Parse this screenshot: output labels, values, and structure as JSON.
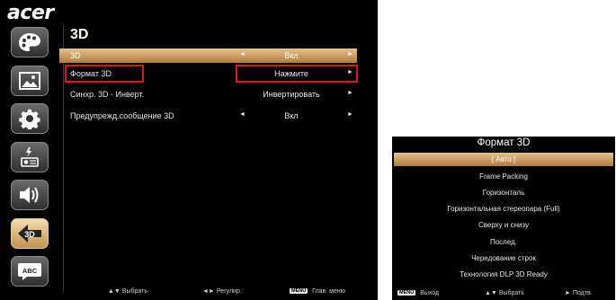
{
  "brand": "acer",
  "page_title": "3D",
  "sidebar": [
    {
      "icon": "palette-icon",
      "active": false
    },
    {
      "icon": "image-icon",
      "active": false
    },
    {
      "icon": "gear-icon",
      "active": false
    },
    {
      "icon": "projector-power-icon",
      "active": false
    },
    {
      "icon": "speaker-icon",
      "active": false
    },
    {
      "icon": "3d-icon",
      "active": true,
      "badge": "3D"
    },
    {
      "icon": "language-icon",
      "active": false,
      "badge": "ABC"
    }
  ],
  "menu": [
    {
      "label": "3D",
      "value": "Вкл",
      "left_arrow": "◄",
      "right_arrow": "►",
      "selected": true
    },
    {
      "label": "Формат 3D",
      "value": "Нажмите",
      "left_arrow": "",
      "right_arrow": "►",
      "selected": false
    },
    {
      "label": "Синхр. 3D - Инверт.",
      "value": "Инвертировать",
      "left_arrow": "",
      "right_arrow": "►",
      "selected": false
    },
    {
      "label": "Предупрежд.сообщение 3D",
      "value": "Вкл",
      "left_arrow": "◄",
      "right_arrow": "►",
      "selected": false
    }
  ],
  "footer": {
    "select_icon": "▲▼",
    "select_label": "Выбрать",
    "adjust_icon": "◄►",
    "adjust_label": "Регулир.",
    "menu_key": "MENU",
    "menu_label": "Глав. меню"
  },
  "submenu": {
    "title": "Формат 3D",
    "options": [
      "[ Авто ]",
      "Frame Packing",
      "Горизонталь",
      "Горизонтальная стереопара (Full)",
      "Сверху и снизу",
      "Послед.",
      "Чередование строк",
      "Технология DLP 3D Ready"
    ],
    "selected_index": 0,
    "footer": {
      "menu_key": "MENU",
      "exit_label": "Выход",
      "select_icon": "▲▼",
      "select_label": "Выбрать",
      "confirm_icon": "►",
      "confirm_label": "Подтв."
    }
  },
  "colors": {
    "highlight_top": "#e5c28c",
    "highlight_bottom": "#b07c3e",
    "annotation": "#e0141e"
  }
}
